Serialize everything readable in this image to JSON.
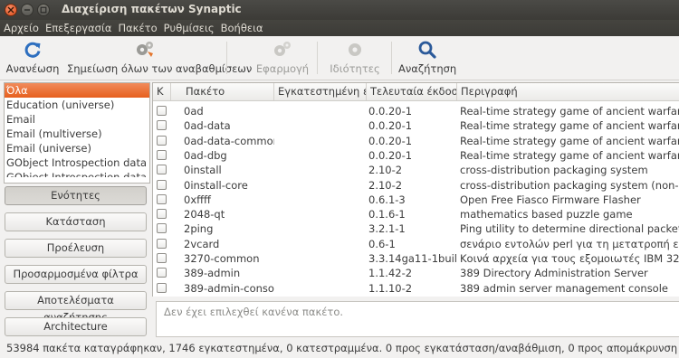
{
  "window": {
    "title": "Διαχείριση πακέτων Synaptic"
  },
  "menu": [
    "Αρχείο",
    "Επεξεργασία",
    "Πακέτο",
    "Ρυθμίσεις",
    "Βοήθεια"
  ],
  "toolbar": {
    "reload": "Ανανέωση",
    "mark_all_upgrades": "Σημείωση όλων των αναβαθμίσεων",
    "apply": "Εφαρμογή",
    "properties": "Ιδιότητες",
    "search": "Αναζήτηση"
  },
  "categories": [
    "Όλα",
    "Education (universe)",
    "Email",
    "Email (multiverse)",
    "Email (universe)",
    "GObject Introspection data",
    "GObject Introspection data (u"
  ],
  "filter_buttons": [
    "Ενότητες",
    "Κατάσταση",
    "Προέλευση",
    "Προσαρμοσμένα φίλτρα",
    "Αποτελέσματα αναζήτησης",
    "Architecture"
  ],
  "columns": {
    "status": "Κ",
    "package": "Πακέτο",
    "installed": "Εγκατεστημένη έκ",
    "latest": "Τελευταία έκδοση",
    "description": "Περιγραφή"
  },
  "packages": [
    {
      "name": "0ad",
      "latest": "0.0.20-1",
      "desc": "Real-time strategy game of ancient warfare"
    },
    {
      "name": "0ad-data",
      "latest": "0.0.20-1",
      "desc": "Real-time strategy game of ancient warfare (d"
    },
    {
      "name": "0ad-data-common",
      "latest": "0.0.20-1",
      "desc": "Real-time strategy game of ancient warfare (c"
    },
    {
      "name": "0ad-dbg",
      "latest": "0.0.20-1",
      "desc": "Real-time strategy game of ancient warfare (d"
    },
    {
      "name": "0install",
      "latest": "2.10-2",
      "desc": "cross-distribution packaging system"
    },
    {
      "name": "0install-core",
      "latest": "2.10-2",
      "desc": "cross-distribution packaging system (non-GUI"
    },
    {
      "name": "0xffff",
      "latest": "0.6.1-3",
      "desc": "Open Free Fiasco Firmware Flasher"
    },
    {
      "name": "2048-qt",
      "latest": "0.1.6-1",
      "desc": "mathematics based puzzle game"
    },
    {
      "name": "2ping",
      "latest": "3.2.1-1",
      "desc": "Ping utility to determine directional packet lo"
    },
    {
      "name": "2vcard",
      "latest": "0.6-1",
      "desc": "σενάριο εντολών perl για τη μετατροπή ενός"
    },
    {
      "name": "3270-common",
      "latest": "3.3.14ga11-1build1",
      "desc": "Κοινά αρχεία για τους εξομοιωτές IBM 3270 κ"
    },
    {
      "name": "389-admin",
      "latest": "1.1.42-2",
      "desc": "389 Directory Administration Server"
    },
    {
      "name": "389-admin-console",
      "latest": "1.1.10-2",
      "desc": "389 admin server management console"
    }
  ],
  "description_pane": "Δεν έχει επιλεχθεί κανένα πακέτο.",
  "statusbar": "53984 πακέτα καταγράφηκαν, 1746 εγκατεστημένα, 0 κατεστραμμένα. 0 προς εγκατάσταση/αναβάθμιση, 0 προς απομάκρυνση"
}
